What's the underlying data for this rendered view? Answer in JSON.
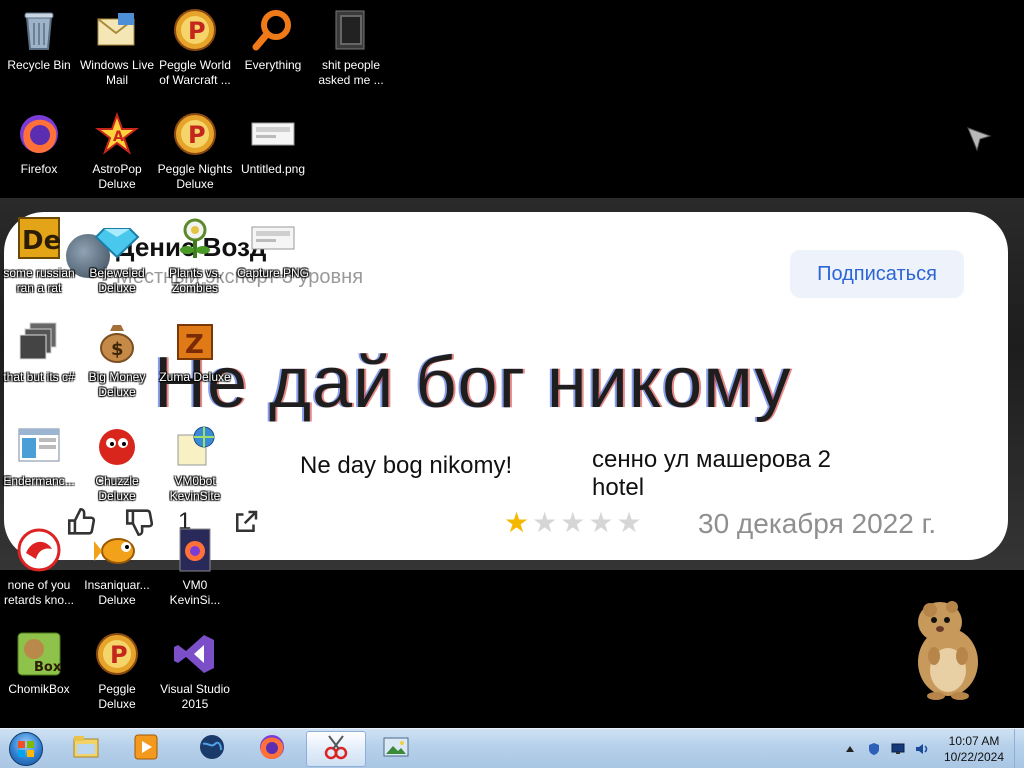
{
  "desktop": {
    "icons": [
      {
        "label": "Recycle Bin",
        "icon": "recycle-bin-icon"
      },
      {
        "label": "Windows Live Mail",
        "icon": "mail-icon"
      },
      {
        "label": "Peggle World of Warcraft ...",
        "icon": "peggle-icon"
      },
      {
        "label": "Everything",
        "icon": "magnifier-icon"
      },
      {
        "label": "shit people asked me ...",
        "icon": "folder-icon"
      },
      {
        "label": "Firefox",
        "icon": "firefox-icon"
      },
      {
        "label": "AstroPop Deluxe",
        "icon": "astropop-icon"
      },
      {
        "label": "Peggle Nights Deluxe",
        "icon": "peggle-icon"
      },
      {
        "label": "Untitled.png",
        "icon": "image-file-icon"
      },
      {
        "label": "some russian ran a rat",
        "icon": "de-icon"
      },
      {
        "label": "Bejeweled Deluxe",
        "icon": "gem-icon"
      },
      {
        "label": "Plants vs. Zombies",
        "icon": "plant-icon"
      },
      {
        "label": "Capture.PNG",
        "icon": "image-file-icon"
      },
      {
        "label": "that but its c#",
        "icon": "windows-stack-icon"
      },
      {
        "label": "Big Money Deluxe",
        "icon": "money-bag-icon"
      },
      {
        "label": "Zuma Deluxe",
        "icon": "zuma-icon"
      },
      {
        "label": "Endermanc...",
        "icon": "window-file-icon"
      },
      {
        "label": "Chuzzle Deluxe",
        "icon": "chuzzle-icon"
      },
      {
        "label": "VM0bot KevinSite",
        "icon": "web-shortcut-icon"
      },
      {
        "label": "none of you retards kno...",
        "icon": "red-logo-icon"
      },
      {
        "label": "Insaniquar... Deluxe",
        "icon": "fish-icon"
      },
      {
        "label": "VM0 KevinSi...",
        "icon": "firefox-file-icon"
      },
      {
        "label": "ChomikBox",
        "icon": "chomikbox-icon"
      },
      {
        "label": "Peggle Deluxe",
        "icon": "peggle-icon"
      },
      {
        "label": "Visual Studio 2015",
        "icon": "visual-studio-icon"
      }
    ]
  },
  "review_card": {
    "author": "Денис Возд",
    "level": "Местный эксперт 3 уровня",
    "subscribe_label": "Подписаться",
    "headline": "Не дай бог никому",
    "caption_left": "Ne day bog nikomy!",
    "caption_right": "сенно ул машерова 2 hotel",
    "dislike_count": "1",
    "rating": 1,
    "rating_max": 5,
    "date": "30 декабря 2022 г.",
    "colors": {
      "subscribe_text": "#2c64d6",
      "star_on": "#f5b800",
      "star_off": "#d6d6d6"
    }
  },
  "taskbar": {
    "items": [
      {
        "name": "explorer-icon"
      },
      {
        "name": "media-player-icon"
      },
      {
        "name": "globe-icon"
      },
      {
        "name": "firefox-icon"
      },
      {
        "name": "snipping-tool-icon",
        "active": true
      },
      {
        "name": "picture-viewer-icon"
      }
    ],
    "clock_time": "10:07 AM",
    "clock_date": "10/22/2024"
  }
}
